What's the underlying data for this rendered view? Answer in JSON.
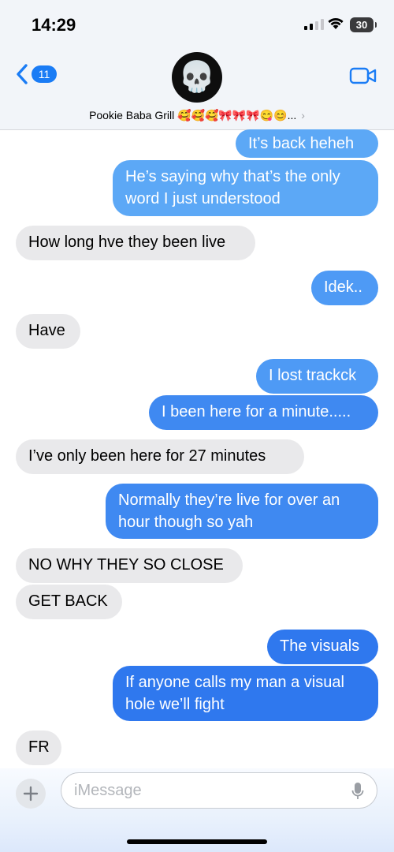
{
  "status": {
    "time": "14:29",
    "battery": "30"
  },
  "header": {
    "back_badge": "11",
    "chat_name": "Pookie Baba Grill 🥰🥰🥰🎀🎀🎀😋😊...",
    "chevron": "›",
    "avatar_emoji": "💀"
  },
  "messages": [
    {
      "dir": "out",
      "lines": [
        "It’s back heheh"
      ]
    },
    {
      "dir": "out",
      "lines": [
        "He’s saying why that’s the only",
        "word I just understood"
      ]
    },
    {
      "dir": "in",
      "lines": [
        "How long hve they been live"
      ]
    },
    {
      "dir": "out",
      "lines": [
        "Idek.."
      ]
    },
    {
      "dir": "in",
      "lines": [
        "Have"
      ]
    },
    {
      "dir": "out",
      "lines": [
        "I lost trackck"
      ]
    },
    {
      "dir": "out",
      "lines": [
        "I been here for a minute....."
      ]
    },
    {
      "dir": "in",
      "lines": [
        "I’ve only been here for 27 minutes"
      ]
    },
    {
      "dir": "out",
      "lines": [
        "Normally they’re live for over an",
        "hour though so yah"
      ]
    },
    {
      "dir": "in",
      "lines": [
        "NO WHY THEY SO CLOSE"
      ]
    },
    {
      "dir": "in",
      "lines": [
        "GET BACK"
      ]
    },
    {
      "dir": "out",
      "lines": [
        "The visuals"
      ]
    },
    {
      "dir": "out",
      "lines": [
        "If anyone calls my man a visual",
        "hole we’ll fight"
      ]
    },
    {
      "dir": "in",
      "lines": [
        "FR"
      ]
    }
  ],
  "composer": {
    "placeholder": "iMessage"
  },
  "colors": {
    "accent": "#1a7cf5",
    "incoming_bubble": "#e9e9eb"
  },
  "icons": [
    "back-chevron-icon",
    "video-camera-icon",
    "plus-icon",
    "microphone-icon",
    "wifi-icon",
    "signal-icon"
  ]
}
